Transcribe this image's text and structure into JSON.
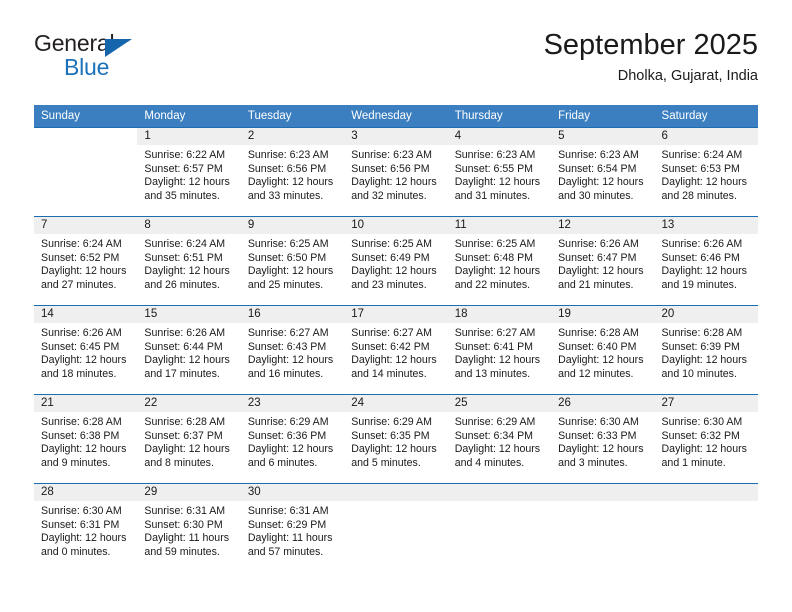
{
  "brand": {
    "name_part1": "General",
    "name_part2": "Blue",
    "triangle_color": "#1565ad",
    "blue_color": "#1b72ba"
  },
  "header": {
    "title": "September 2025",
    "subtitle": "Dholka, Gujarat, India"
  },
  "theme": {
    "header_row_bg": "#3c7fc1",
    "row_border": "#1b6cb0",
    "daynum_bg": "#efefef"
  },
  "weekdays": [
    "Sunday",
    "Monday",
    "Tuesday",
    "Wednesday",
    "Thursday",
    "Friday",
    "Saturday"
  ],
  "weeks": [
    [
      {
        "day": "",
        "sunrise": "",
        "sunset": "",
        "daylight1": "",
        "daylight2": "",
        "blank": true
      },
      {
        "day": "1",
        "sunrise": "Sunrise: 6:22 AM",
        "sunset": "Sunset: 6:57 PM",
        "daylight1": "Daylight: 12 hours",
        "daylight2": "and 35 minutes."
      },
      {
        "day": "2",
        "sunrise": "Sunrise: 6:23 AM",
        "sunset": "Sunset: 6:56 PM",
        "daylight1": "Daylight: 12 hours",
        "daylight2": "and 33 minutes."
      },
      {
        "day": "3",
        "sunrise": "Sunrise: 6:23 AM",
        "sunset": "Sunset: 6:56 PM",
        "daylight1": "Daylight: 12 hours",
        "daylight2": "and 32 minutes."
      },
      {
        "day": "4",
        "sunrise": "Sunrise: 6:23 AM",
        "sunset": "Sunset: 6:55 PM",
        "daylight1": "Daylight: 12 hours",
        "daylight2": "and 31 minutes."
      },
      {
        "day": "5",
        "sunrise": "Sunrise: 6:23 AM",
        "sunset": "Sunset: 6:54 PM",
        "daylight1": "Daylight: 12 hours",
        "daylight2": "and 30 minutes."
      },
      {
        "day": "6",
        "sunrise": "Sunrise: 6:24 AM",
        "sunset": "Sunset: 6:53 PM",
        "daylight1": "Daylight: 12 hours",
        "daylight2": "and 28 minutes."
      }
    ],
    [
      {
        "day": "7",
        "sunrise": "Sunrise: 6:24 AM",
        "sunset": "Sunset: 6:52 PM",
        "daylight1": "Daylight: 12 hours",
        "daylight2": "and 27 minutes."
      },
      {
        "day": "8",
        "sunrise": "Sunrise: 6:24 AM",
        "sunset": "Sunset: 6:51 PM",
        "daylight1": "Daylight: 12 hours",
        "daylight2": "and 26 minutes."
      },
      {
        "day": "9",
        "sunrise": "Sunrise: 6:25 AM",
        "sunset": "Sunset: 6:50 PM",
        "daylight1": "Daylight: 12 hours",
        "daylight2": "and 25 minutes."
      },
      {
        "day": "10",
        "sunrise": "Sunrise: 6:25 AM",
        "sunset": "Sunset: 6:49 PM",
        "daylight1": "Daylight: 12 hours",
        "daylight2": "and 23 minutes."
      },
      {
        "day": "11",
        "sunrise": "Sunrise: 6:25 AM",
        "sunset": "Sunset: 6:48 PM",
        "daylight1": "Daylight: 12 hours",
        "daylight2": "and 22 minutes."
      },
      {
        "day": "12",
        "sunrise": "Sunrise: 6:26 AM",
        "sunset": "Sunset: 6:47 PM",
        "daylight1": "Daylight: 12 hours",
        "daylight2": "and 21 minutes."
      },
      {
        "day": "13",
        "sunrise": "Sunrise: 6:26 AM",
        "sunset": "Sunset: 6:46 PM",
        "daylight1": "Daylight: 12 hours",
        "daylight2": "and 19 minutes."
      }
    ],
    [
      {
        "day": "14",
        "sunrise": "Sunrise: 6:26 AM",
        "sunset": "Sunset: 6:45 PM",
        "daylight1": "Daylight: 12 hours",
        "daylight2": "and 18 minutes."
      },
      {
        "day": "15",
        "sunrise": "Sunrise: 6:26 AM",
        "sunset": "Sunset: 6:44 PM",
        "daylight1": "Daylight: 12 hours",
        "daylight2": "and 17 minutes."
      },
      {
        "day": "16",
        "sunrise": "Sunrise: 6:27 AM",
        "sunset": "Sunset: 6:43 PM",
        "daylight1": "Daylight: 12 hours",
        "daylight2": "and 16 minutes."
      },
      {
        "day": "17",
        "sunrise": "Sunrise: 6:27 AM",
        "sunset": "Sunset: 6:42 PM",
        "daylight1": "Daylight: 12 hours",
        "daylight2": "and 14 minutes."
      },
      {
        "day": "18",
        "sunrise": "Sunrise: 6:27 AM",
        "sunset": "Sunset: 6:41 PM",
        "daylight1": "Daylight: 12 hours",
        "daylight2": "and 13 minutes."
      },
      {
        "day": "19",
        "sunrise": "Sunrise: 6:28 AM",
        "sunset": "Sunset: 6:40 PM",
        "daylight1": "Daylight: 12 hours",
        "daylight2": "and 12 minutes."
      },
      {
        "day": "20",
        "sunrise": "Sunrise: 6:28 AM",
        "sunset": "Sunset: 6:39 PM",
        "daylight1": "Daylight: 12 hours",
        "daylight2": "and 10 minutes."
      }
    ],
    [
      {
        "day": "21",
        "sunrise": "Sunrise: 6:28 AM",
        "sunset": "Sunset: 6:38 PM",
        "daylight1": "Daylight: 12 hours",
        "daylight2": "and 9 minutes."
      },
      {
        "day": "22",
        "sunrise": "Sunrise: 6:28 AM",
        "sunset": "Sunset: 6:37 PM",
        "daylight1": "Daylight: 12 hours",
        "daylight2": "and 8 minutes."
      },
      {
        "day": "23",
        "sunrise": "Sunrise: 6:29 AM",
        "sunset": "Sunset: 6:36 PM",
        "daylight1": "Daylight: 12 hours",
        "daylight2": "and 6 minutes."
      },
      {
        "day": "24",
        "sunrise": "Sunrise: 6:29 AM",
        "sunset": "Sunset: 6:35 PM",
        "daylight1": "Daylight: 12 hours",
        "daylight2": "and 5 minutes."
      },
      {
        "day": "25",
        "sunrise": "Sunrise: 6:29 AM",
        "sunset": "Sunset: 6:34 PM",
        "daylight1": "Daylight: 12 hours",
        "daylight2": "and 4 minutes."
      },
      {
        "day": "26",
        "sunrise": "Sunrise: 6:30 AM",
        "sunset": "Sunset: 6:33 PM",
        "daylight1": "Daylight: 12 hours",
        "daylight2": "and 3 minutes."
      },
      {
        "day": "27",
        "sunrise": "Sunrise: 6:30 AM",
        "sunset": "Sunset: 6:32 PM",
        "daylight1": "Daylight: 12 hours",
        "daylight2": "and 1 minute."
      }
    ],
    [
      {
        "day": "28",
        "sunrise": "Sunrise: 6:30 AM",
        "sunset": "Sunset: 6:31 PM",
        "daylight1": "Daylight: 12 hours",
        "daylight2": "and 0 minutes."
      },
      {
        "day": "29",
        "sunrise": "Sunrise: 6:31 AM",
        "sunset": "Sunset: 6:30 PM",
        "daylight1": "Daylight: 11 hours",
        "daylight2": "and 59 minutes."
      },
      {
        "day": "30",
        "sunrise": "Sunrise: 6:31 AM",
        "sunset": "Sunset: 6:29 PM",
        "daylight1": "Daylight: 11 hours",
        "daylight2": "and 57 minutes."
      },
      {
        "day": "",
        "sunrise": "",
        "sunset": "",
        "daylight1": "",
        "daylight2": "",
        "empty": true
      },
      {
        "day": "",
        "sunrise": "",
        "sunset": "",
        "daylight1": "",
        "daylight2": "",
        "empty": true
      },
      {
        "day": "",
        "sunrise": "",
        "sunset": "",
        "daylight1": "",
        "daylight2": "",
        "empty": true
      },
      {
        "day": "",
        "sunrise": "",
        "sunset": "",
        "daylight1": "",
        "daylight2": "",
        "empty": true
      }
    ]
  ]
}
